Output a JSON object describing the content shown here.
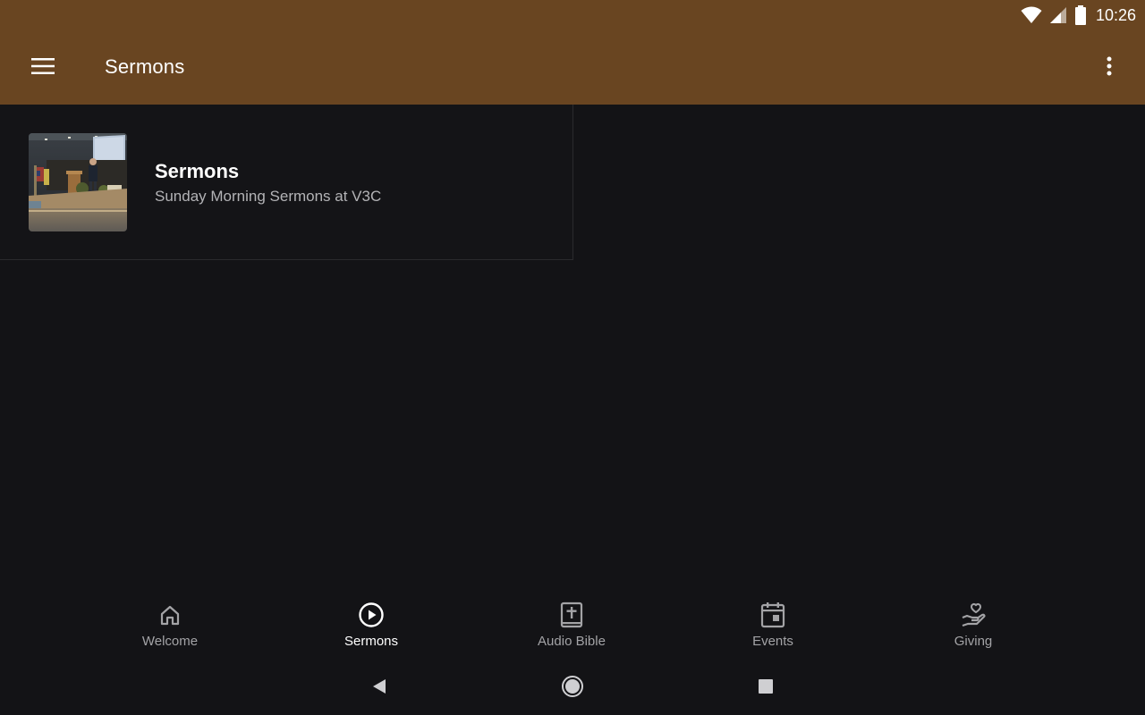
{
  "status_bar": {
    "time": "10:26",
    "icons": [
      "wifi-icon",
      "cell-signal-icon",
      "battery-icon"
    ]
  },
  "app_bar": {
    "title": "Sermons",
    "background": "#694521",
    "menu_icon": "hamburger-menu-icon",
    "overflow_icon": "more-vert-icon"
  },
  "content": {
    "items": [
      {
        "title": "Sermons",
        "subtitle": "Sunday Morning Sermons at V3C",
        "thumbnail": "sermon-thumbnail"
      }
    ]
  },
  "bottom_nav": {
    "items": [
      {
        "label": "Welcome",
        "icon": "home-icon",
        "active": false
      },
      {
        "label": "Sermons",
        "icon": "play-circle-icon",
        "active": true
      },
      {
        "label": "Audio Bible",
        "icon": "bible-icon",
        "active": false
      },
      {
        "label": "Events",
        "icon": "calendar-icon",
        "active": false
      },
      {
        "label": "Giving",
        "icon": "giving-hand-icon",
        "active": false
      }
    ]
  },
  "system_nav": {
    "buttons": [
      "back-icon",
      "home-circle-icon",
      "recents-icon"
    ]
  },
  "colors": {
    "background": "#131316",
    "accent": "#694521",
    "inactive_label": "#a3a3a6",
    "subtitle": "#b3b3b6"
  }
}
